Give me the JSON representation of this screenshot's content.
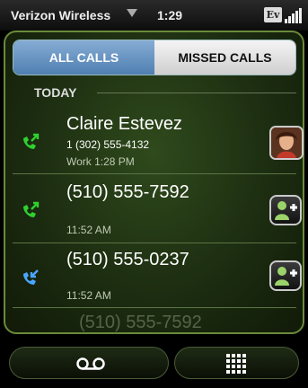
{
  "status": {
    "carrier": "Verizon Wireless",
    "time": "1:29",
    "network_badge": "Ev",
    "signal_icon": "signal-bars-icon"
  },
  "tabs": [
    {
      "label": "ALL CALLS",
      "selected": true
    },
    {
      "label": "MISSED CALLS",
      "selected": false
    }
  ],
  "section": "TODAY",
  "calls": [
    {
      "name": "Claire Estevez",
      "number": "1 (302) 555-4132",
      "time": "Work 1:28 PM",
      "type": "outgoing",
      "icon_color": "#2fd12f",
      "action": "contact-photo"
    },
    {
      "name": "(510) 555-7592",
      "number": "",
      "time": "11:52 AM",
      "type": "outgoing",
      "icon_color": "#2fd12f",
      "action": "add-contact"
    },
    {
      "name": "(510) 555-0237",
      "number": "",
      "time": "11:52 AM",
      "type": "incoming",
      "icon_color": "#4aa6ff",
      "action": "add-contact"
    },
    {
      "name": "(510) 555-7592",
      "number": "",
      "time": "",
      "type": "outgoing",
      "icon_color": "#2fd12f",
      "action": ""
    }
  ],
  "bottom": {
    "voicemail_icon": "voicemail-icon",
    "dialpad_icon": "dialpad-icon"
  },
  "colors": {
    "tab_selected": "#4f7fb1",
    "frame_border": "#6a8a3a",
    "outgoing": "#2fd12f",
    "incoming": "#4aa6ff"
  }
}
